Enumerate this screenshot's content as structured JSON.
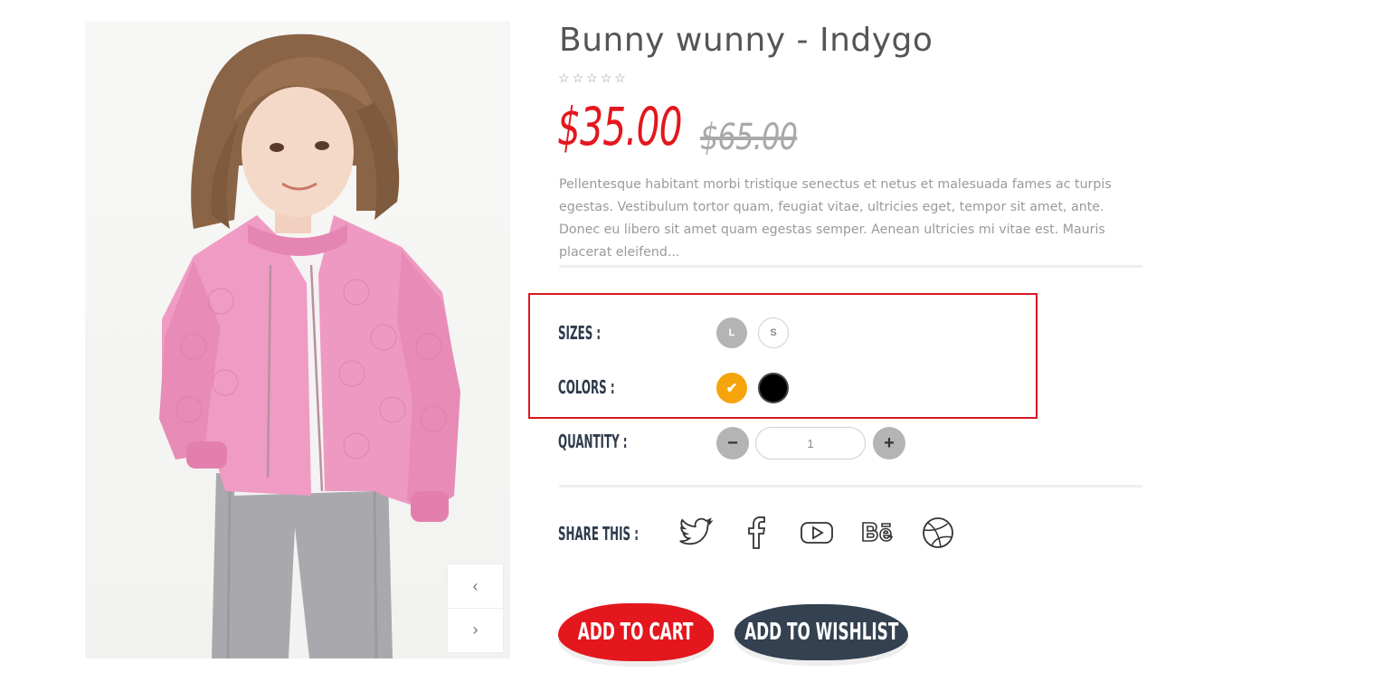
{
  "product": {
    "title": "Bunny wunny - Indygo",
    "rating": {
      "value": 0,
      "max": 5
    },
    "price": "$35.00",
    "old_price": "$65.00",
    "description": "Pellentesque habitant morbi tristique senectus et netus et malesuada fames ac turpis egestas. Vestibulum tortor quam, feugiat vitae, ultricies eget, tempor sit amet, ante. Donec eu libero sit amet quam egestas semper. Aenean ultricies mi vitae est. Mauris placerat eleifend..."
  },
  "gallery": {
    "prev_icon": "chevron-left-icon",
    "next_icon": "chevron-right-icon"
  },
  "options": {
    "sizes_label": "SIZES :",
    "sizes": [
      {
        "label": "L",
        "selected": true
      },
      {
        "label": "S",
        "selected": false
      }
    ],
    "colors_label": "COLORS :",
    "colors": [
      {
        "value": "#f5a40c",
        "selected": true
      },
      {
        "value": "#000000",
        "selected": false
      }
    ],
    "quantity_label": "QUANTITY :",
    "quantity_value": "1",
    "minus_symbol": "−",
    "plus_symbol": "+"
  },
  "share": {
    "label": "SHARE THIS :",
    "icons": [
      "twitter-icon",
      "facebook-icon",
      "youtube-icon",
      "behance-icon",
      "dribbble-icon"
    ]
  },
  "actions": {
    "add_to_cart": "ADD TO CART",
    "add_to_wishlist": "ADD TO WISHLIST"
  },
  "colors": {
    "accent_red": "#e3171d",
    "dark_navy": "#334150",
    "highlight_border": "#d71920"
  }
}
